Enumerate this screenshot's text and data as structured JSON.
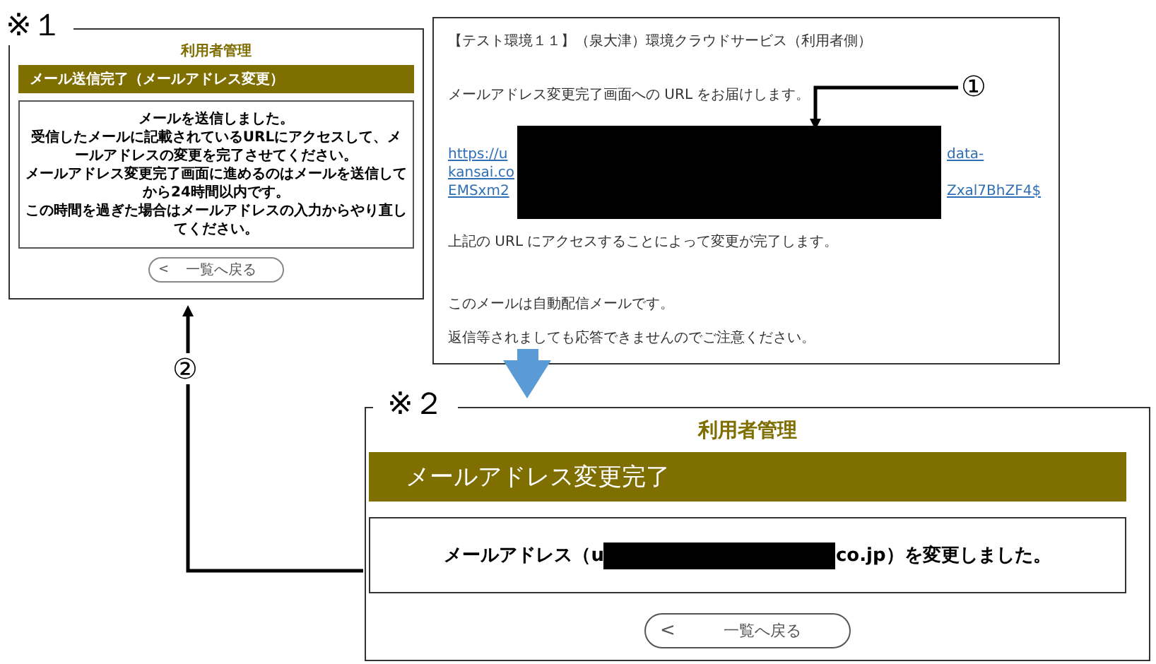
{
  "screen_1": {
    "label": "※１",
    "app_title": "利用者管理",
    "heading": "メール送信完了（メールアドレス変更）",
    "message_lines": [
      "メールを送信しました。",
      "受信したメールに記載されているURLにアクセスして、メールアドレスの変更を完了させてください。",
      "メールアドレス変更完了画面に進めるのはメールを送信してから24時間以内です。",
      "この時間を過ぎた場合はメールアドレスの入力からやり直してください。"
    ],
    "back_button": {
      "arrow": "<",
      "label": "一覧へ戻る"
    }
  },
  "email": {
    "subject": "【テスト環境１１】（泉大津）環境クラウドサービス（利用者側）",
    "intro": "メールアドレス変更完了画面への URL をお届けします。",
    "url_lines": [
      {
        "start": "https://u",
        "end": "data-"
      },
      {
        "start": "kansai.co"
      },
      {
        "start": "EMSxm2",
        "end": "Zxal7BhZF4$"
      }
    ],
    "body_lines": [
      "上記の URL にアクセスすることによって変更が完了します。",
      "このメールは自動配信メールです。",
      "返信等されましても応答できませんのでご注意ください。"
    ]
  },
  "callouts": [
    "①",
    "②"
  ],
  "screen_2": {
    "label": "※２",
    "app_title": "利用者管理",
    "heading": "メールアドレス変更完了",
    "message_parts": [
      {
        "kind": "text",
        "text": "メールアドレス（u"
      },
      {
        "kind": "redacted"
      },
      {
        "kind": "text",
        "text": "co.jp）を変更しました。"
      }
    ],
    "back_button": {
      "arrow": "<",
      "label": "一覧へ戻る"
    }
  }
}
